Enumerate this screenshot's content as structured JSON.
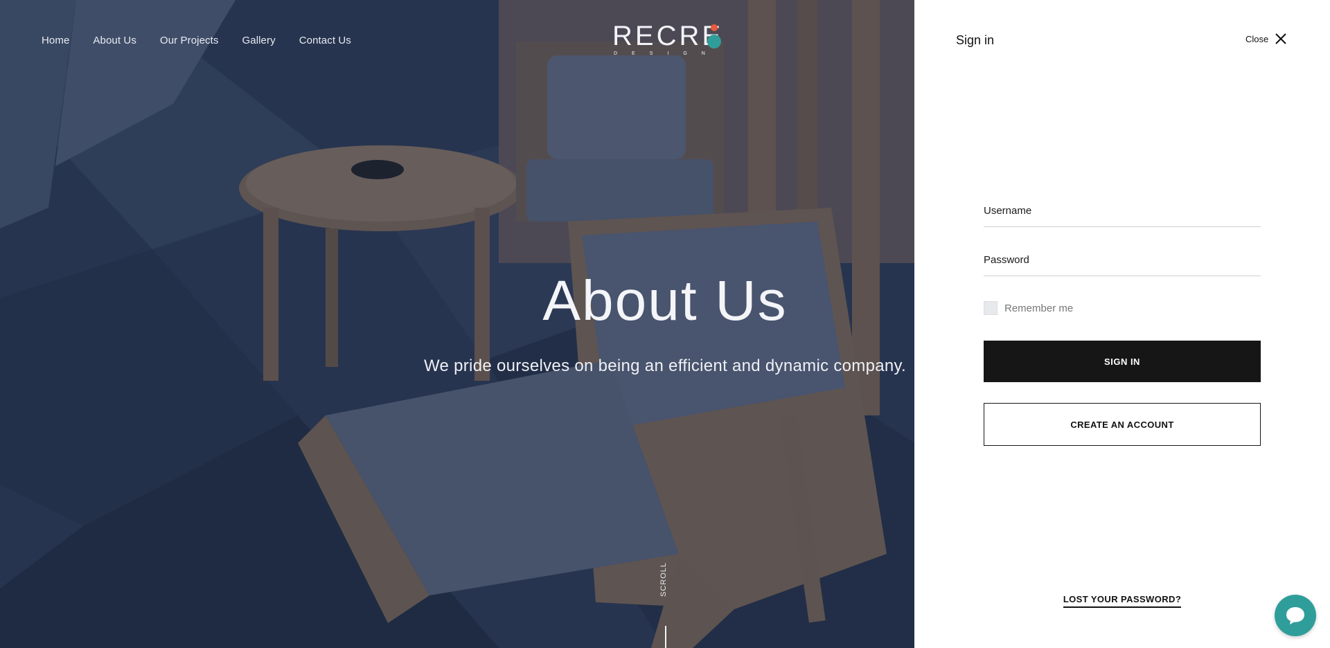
{
  "nav": {
    "items": [
      "Home",
      "About Us",
      "Our Projects",
      "Gallery",
      "Contact Us"
    ]
  },
  "logo": {
    "word": "RECRE",
    "sub": "DESIGN",
    "colors": [
      "#e85a3c",
      "#f1b338",
      "#2f9e9a"
    ]
  },
  "hero": {
    "title": "About Us",
    "subtitle": "We pride ourselves on being an efficient and dynamic company.",
    "scroll": "SCROLL"
  },
  "panel": {
    "title": "Sign in",
    "close_label": "Close",
    "username_label": "Username",
    "password_label": "Password",
    "remember_label": "Remember me",
    "signin_button": "SIGN IN",
    "create_button": "CREATE AN ACCOUNT",
    "lost_password": "LOST YOUR PASSWORD?"
  },
  "chat": {
    "icon": "chat-bubble-icon",
    "color": "#2f9e9a"
  }
}
